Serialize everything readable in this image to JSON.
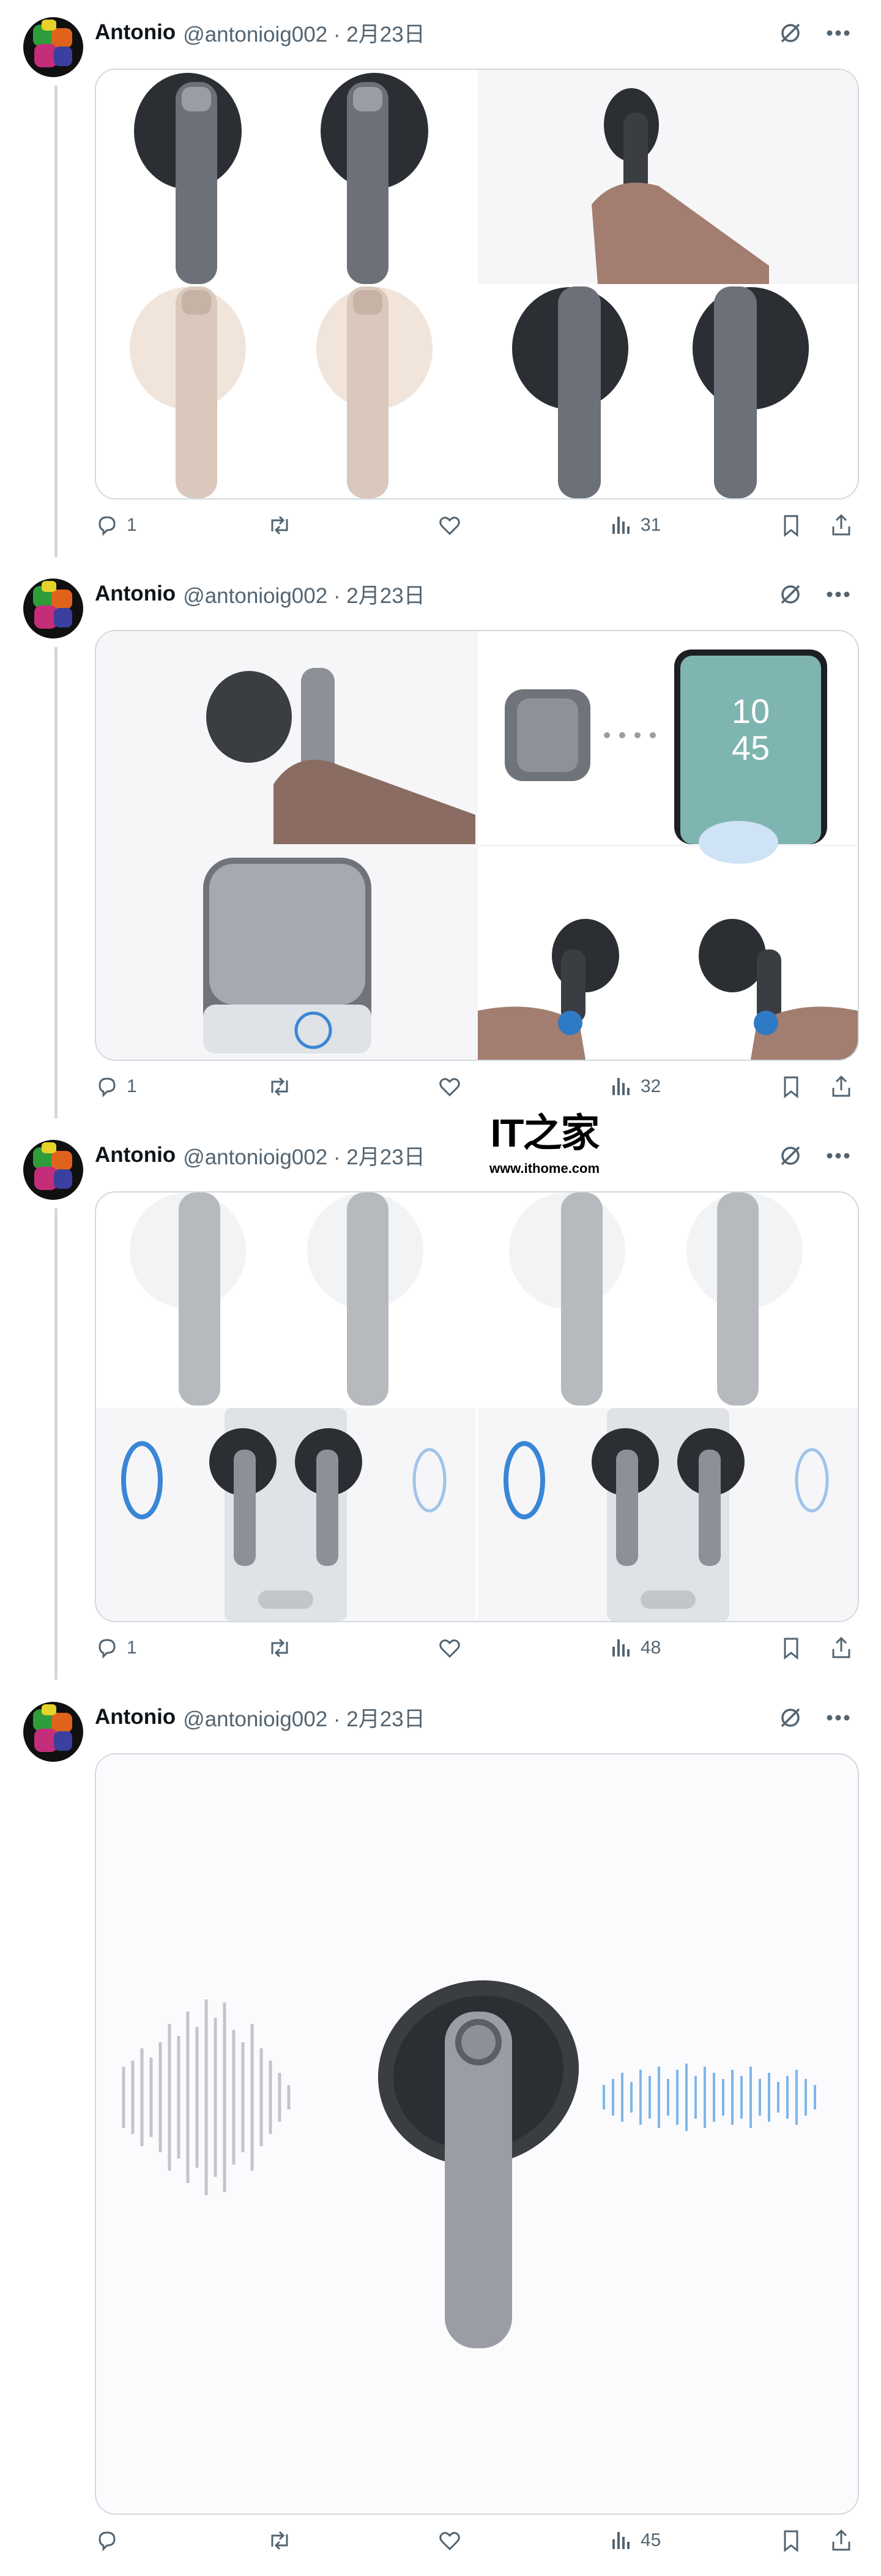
{
  "tweets": [
    {
      "name": "Antonio",
      "handle": "@antonioig002",
      "date": "2月23日",
      "replies": "1",
      "views": "31"
    },
    {
      "name": "Antonio",
      "handle": "@antonioig002",
      "date": "2月23日",
      "replies": "1",
      "views": "32"
    },
    {
      "name": "Antonio",
      "handle": "@antonioig002",
      "date": "2月23日",
      "replies": "1",
      "views": "48"
    },
    {
      "name": "Antonio",
      "handle": "@antonioig002",
      "date": "2月23日",
      "replies": "",
      "views": "45"
    }
  ],
  "phone_clock": {
    "hour": "10",
    "minute": "45"
  },
  "watermark": {
    "logo": "IT之家",
    "url": "www.ithome.com"
  },
  "icons": [
    "grok-icon",
    "more-icon",
    "reply-icon",
    "retweet-icon",
    "like-icon",
    "views-icon",
    "bookmark-icon",
    "share-icon"
  ],
  "colors": {
    "text": "#0f1419",
    "secondary": "#536471",
    "border": "#cfd9de",
    "thread": "#cfd9de"
  }
}
